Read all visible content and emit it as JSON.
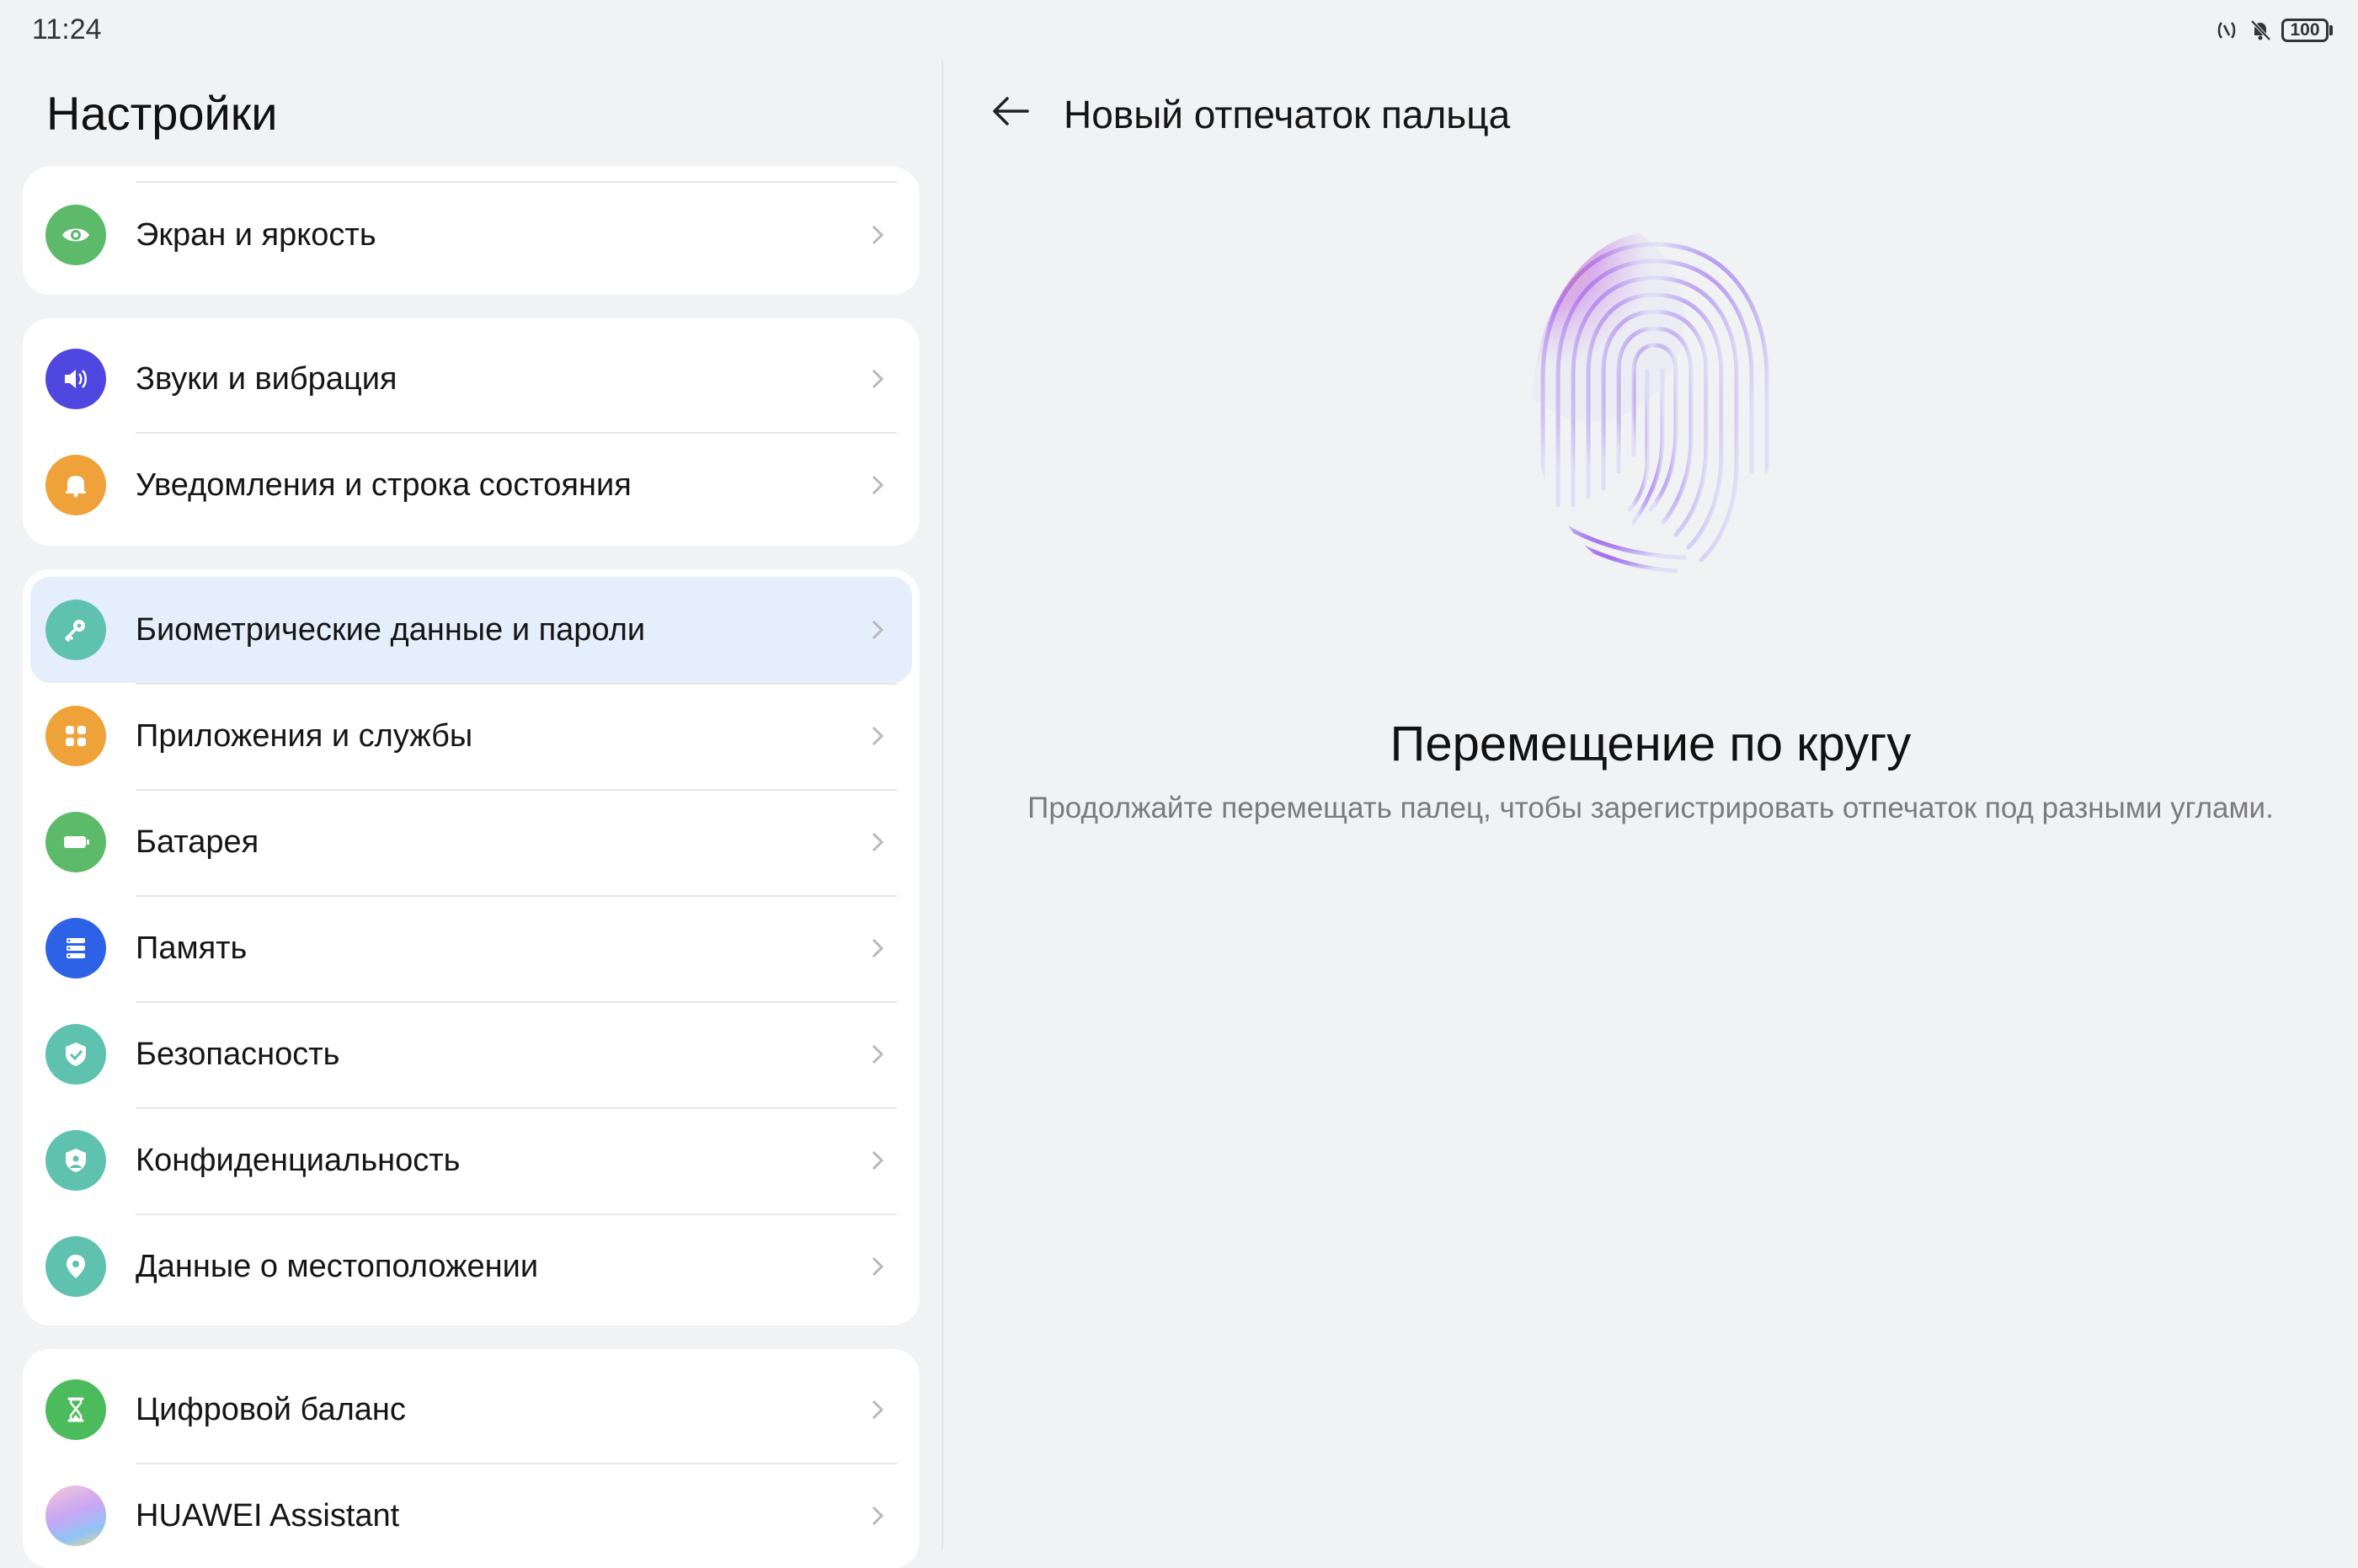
{
  "status_bar": {
    "time": "11:24",
    "icons": [
      "nfc-icon",
      "bell-muted-icon"
    ],
    "battery": "100"
  },
  "settings": {
    "title": "Настройки",
    "groups": [
      {
        "items": [
          {
            "label": "Экран и яркость",
            "icon": "eye-icon",
            "color": "#5cba6a"
          }
        ]
      },
      {
        "items": [
          {
            "label": "Звуки и вибрация",
            "icon": "speaker-icon",
            "color": "#4f46e0"
          },
          {
            "label": "Уведомления и строка состояния",
            "icon": "bell-icon",
            "color": "#f0a23a"
          }
        ]
      },
      {
        "items": [
          {
            "label": "Биометрические данные и пароли",
            "icon": "key-icon",
            "color": "#5fc2ae",
            "selected": true
          },
          {
            "label": "Приложения и службы",
            "icon": "apps-grid-icon",
            "color": "#f0a23a"
          },
          {
            "label": "Батарея",
            "icon": "battery-icon",
            "color": "#5cba6a"
          },
          {
            "label": "Память",
            "icon": "storage-icon",
            "color": "#2e62e6"
          },
          {
            "label": "Безопасность",
            "icon": "shield-check-icon",
            "color": "#5fc2ae"
          },
          {
            "label": "Конфиденциальность",
            "icon": "privacy-shield-icon",
            "color": "#5fc2ae"
          },
          {
            "label": "Данные о местоположении",
            "icon": "location-pin-icon",
            "color": "#5fc2ae"
          }
        ]
      },
      {
        "items": [
          {
            "label": "Цифровой баланс",
            "icon": "hourglass-icon",
            "color": "#4cbb5c"
          },
          {
            "label": "HUAWEI Assistant",
            "icon": "huawei-assistant-icon",
            "color": "#c9a3f0"
          }
        ]
      }
    ]
  },
  "detail": {
    "title": "Новый отпечаток пальца",
    "instruction_title": "Перемещение по кругу",
    "instruction_text": "Продолжайте перемещать палец, чтобы зарегистрировать отпечаток под разными углами."
  }
}
